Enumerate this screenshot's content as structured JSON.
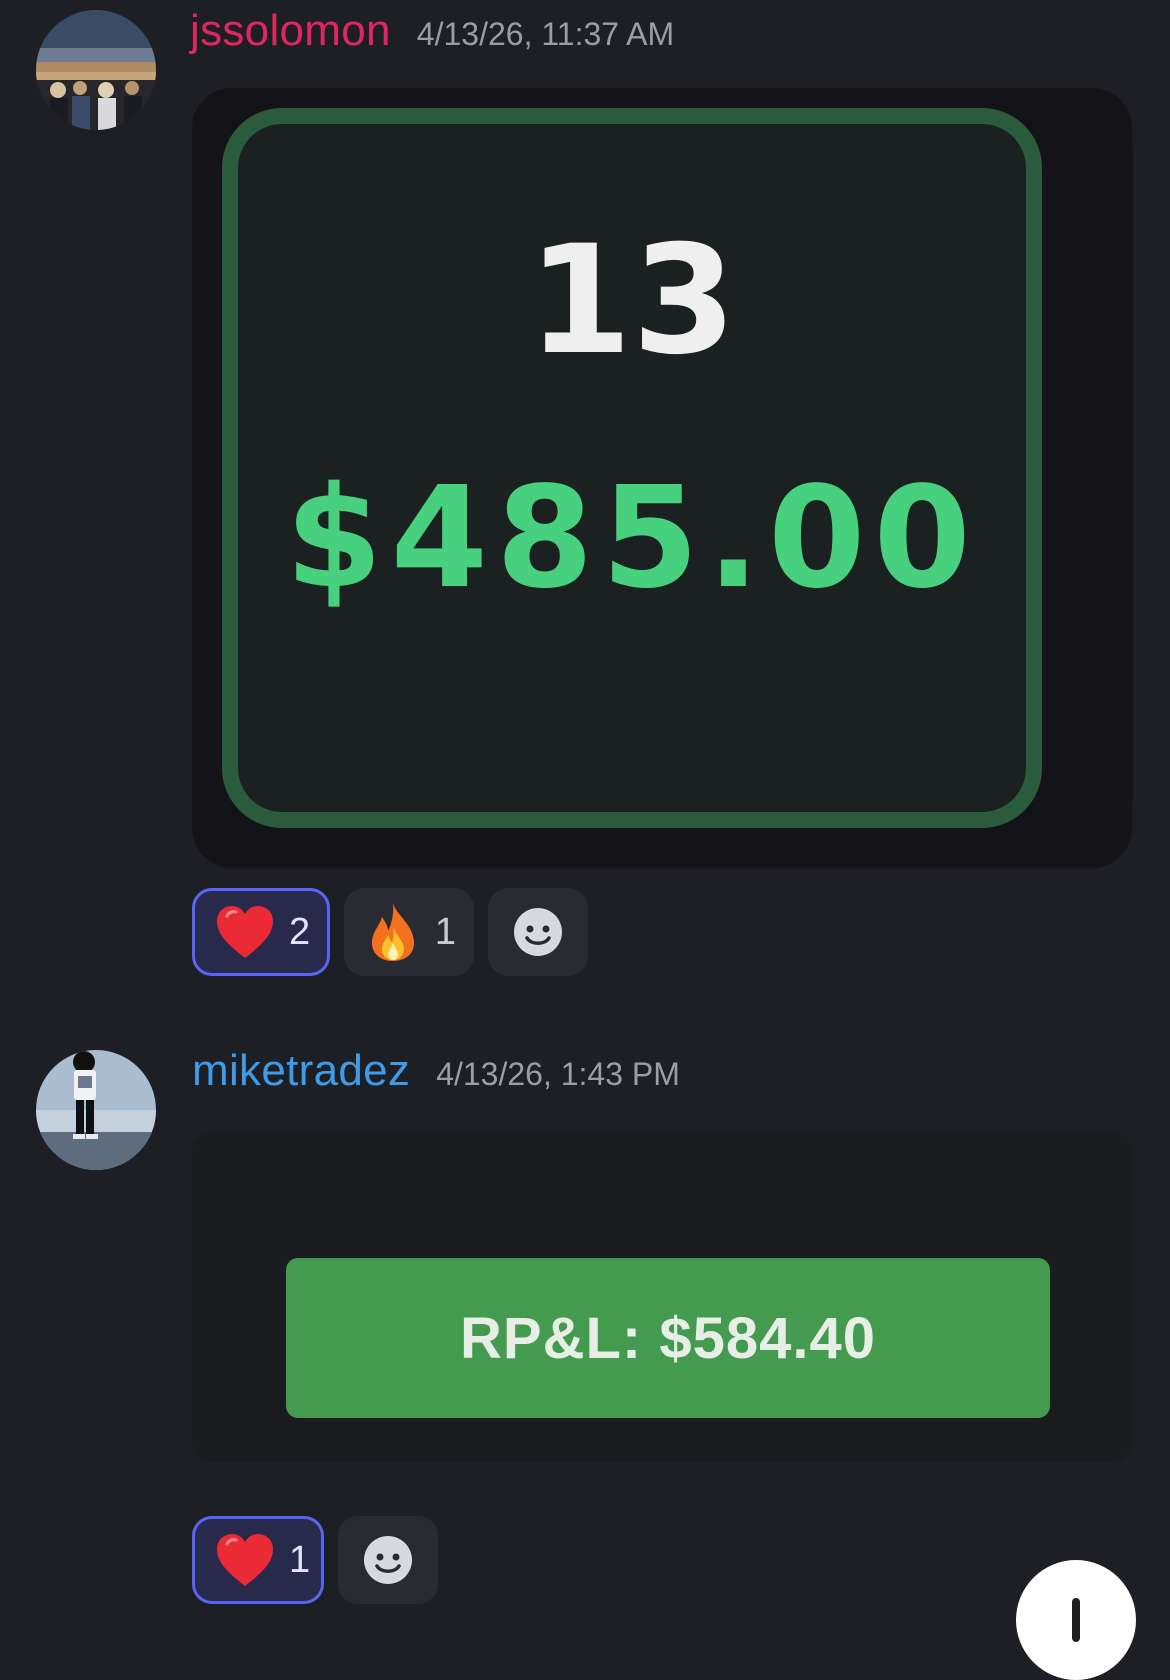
{
  "messages": [
    {
      "username": "jssolomon",
      "username_color": "#e0265f",
      "timestamp": "4/13/26, 11:37 AM",
      "stat_card": {
        "count": "13",
        "amount": "$485.00",
        "amount_color": "#47d17e"
      },
      "reactions": [
        {
          "emoji": "heart-emoji",
          "count": "2",
          "active": true
        },
        {
          "emoji": "fire-emoji",
          "count": "1",
          "active": false
        }
      ]
    },
    {
      "username": "miketradez",
      "username_color": "#3d9be9",
      "timestamp": "4/13/26, 1:43 PM",
      "rpl_label": "RP&L: $584.40",
      "reactions": [
        {
          "emoji": "heart-emoji",
          "count": "1",
          "active": true
        }
      ]
    }
  ]
}
